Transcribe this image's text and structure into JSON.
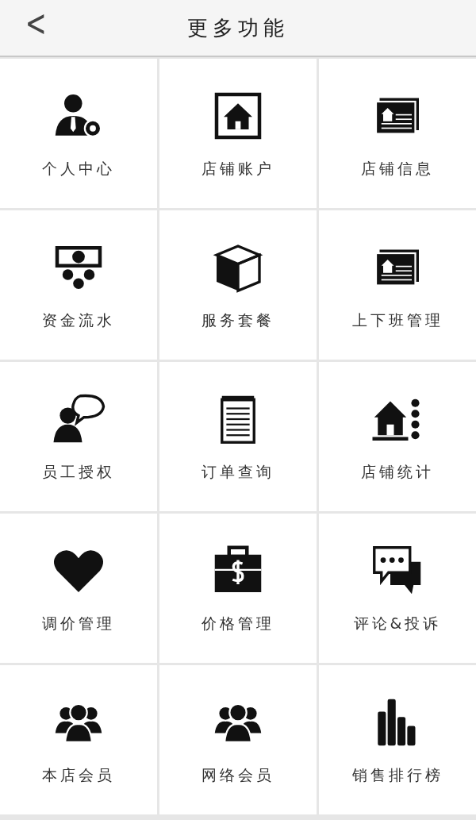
{
  "header": {
    "back": "<",
    "title": "更多功能"
  },
  "items": [
    {
      "label": "个人中心"
    },
    {
      "label": "店铺账户"
    },
    {
      "label": "店铺信息"
    },
    {
      "label": "资金流水"
    },
    {
      "label": "服务套餐"
    },
    {
      "label": "上下班管理"
    },
    {
      "label": "员工授权"
    },
    {
      "label": "订单查询"
    },
    {
      "label": "店铺统计"
    },
    {
      "label": "调价管理"
    },
    {
      "label": "价格管理"
    },
    {
      "label": "评论&投诉"
    },
    {
      "label": "本店会员"
    },
    {
      "label": "网络会员"
    },
    {
      "label": "销售排行榜"
    }
  ]
}
